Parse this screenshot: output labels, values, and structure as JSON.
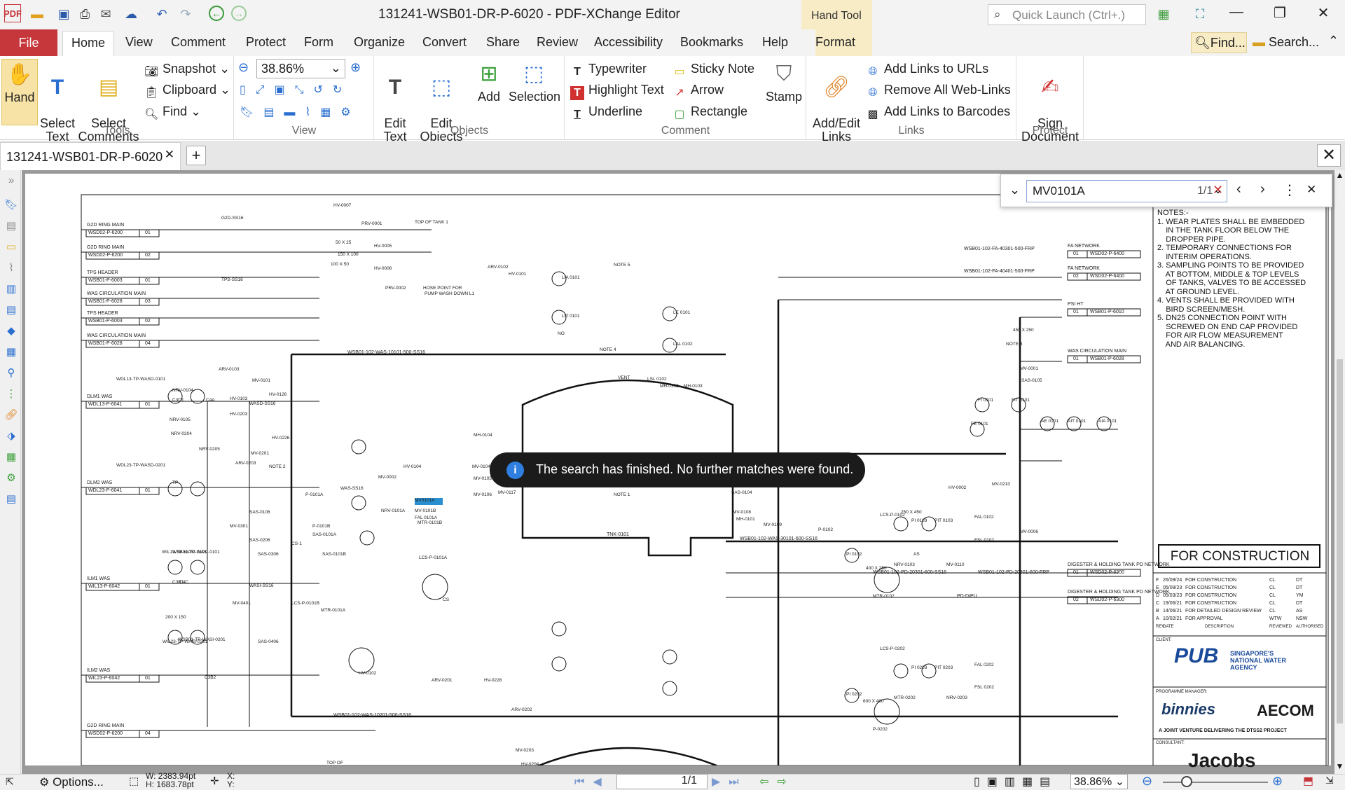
{
  "window": {
    "title": "131241-WSB01-DR-P-6020 - PDF-XChange Editor",
    "context_tab_group": "Hand Tool",
    "quick_launch_placeholder": "Quick Launch (Ctrl+.)"
  },
  "menu": {
    "file": "File",
    "tabs": [
      "Home",
      "View",
      "Comment",
      "Protect",
      "Form",
      "Organize",
      "Convert",
      "Share",
      "Review",
      "Accessibility",
      "Bookmarks",
      "Help"
    ],
    "context_tab": "Format",
    "find_label": "Find...",
    "search_label": "Search..."
  },
  "ribbon": {
    "tools": {
      "label": "Tools",
      "hand": "Hand",
      "select_text": "Select\nText",
      "select_comments": "Select\nComments",
      "snapshot": "Snapshot",
      "clipboard": "Clipboard",
      "find": "Find"
    },
    "view": {
      "label": "View",
      "zoom": "38.86%"
    },
    "objects": {
      "label": "Objects",
      "edit_text": "Edit\nText",
      "edit_objects": "Edit\nObjects",
      "add": "Add",
      "selection": "Selection"
    },
    "comment": {
      "label": "Comment",
      "typewriter": "Typewriter",
      "highlight": "Highlight Text",
      "underline": "Underline",
      "sticky": "Sticky Note",
      "arrow": "Arrow",
      "rectangle": "Rectangle",
      "stamp": "Stamp"
    },
    "links": {
      "label": "Links",
      "add_edit": "Add/Edit\nLinks",
      "add_urls": "Add Links to URLs",
      "remove_web": "Remove All Web-Links",
      "add_barcodes": "Add Links to Barcodes"
    },
    "protect": {
      "label": "Protect",
      "sign": "Sign\nDocument"
    }
  },
  "document_tab": {
    "name": "131241-WSB01-DR-P-6020"
  },
  "find_bar": {
    "query": "MV0101A",
    "count": "1/1"
  },
  "toast": {
    "message": "The search has finished. No further matches were found."
  },
  "drawing": {
    "notes_title": "NOTES:-",
    "notes": [
      "1. WEAR PLATES SHALL BE EMBEDDED",
      "    IN THE TANK FLOOR BELOW THE",
      "    DROPPER PIPE.",
      "2. TEMPORARY CONNECTIONS FOR",
      "    INTERIM OPERATIONS.",
      "3. SAMPLING POINTS TO BE PROVIDED",
      "    AT BOTTOM, MIDDLE & TOP LEVELS",
      "    OF TANKS, VALVES TO BE ACCESSED",
      "    AT GROUND LEVEL.",
      "4. VENTS SHALL BE PROVIDED WITH",
      "    BIRD SCREEN/MESH.",
      "5. DN25 CONNECTION POINT WITH",
      "    SCREWED ON END CAP PROVIDED",
      "    FOR AIR FLOW MEASUREMENT",
      "    AND AIR BALANCING."
    ],
    "stamp": "FOR CONSTRUCTION",
    "revisions": [
      [
        "F",
        "26/09/24",
        "FOR CONSTRUCTION",
        "CL",
        "DT"
      ],
      [
        "E",
        "05/09/23",
        "FOR CONSTRUCTION",
        "CL",
        "DT"
      ],
      [
        "D",
        "05/03/23",
        "FOR CONSTRUCTION",
        "CL",
        "YM"
      ],
      [
        "C",
        "19/06/21",
        "FOR CONSTRUCTION",
        "CL",
        "DT"
      ],
      [
        "B",
        "14/06/21",
        "FOR DETAILED DESIGN REVIEW",
        "CL",
        "AS"
      ],
      [
        "A",
        "10/02/21",
        "FOR APPROVAL",
        "WTW",
        "NSW"
      ]
    ],
    "rev_headers": [
      "REV",
      "DATE",
      "DESCRIPTION",
      "REVIEWED",
      "AUTHORISED"
    ],
    "client_label": "CLIENT:",
    "pub_text": "PUB",
    "pub_sub": "SINGAPORE'S NATIONAL WATER AGENCY",
    "pm_label": "PROGRAMME MANAGER:",
    "binnies": "binnies",
    "aecom": "AECOM",
    "jv_text": "A JOINT VENTURE DELIVERING THE DTSS2 PROJECT",
    "consultant_label": "CONSULTANT:",
    "jacobs": "Jacobs",
    "left_labels": [
      [
        "G2D RING MAIN",
        "WSD02-P-6200",
        "01"
      ],
      [
        "G2D RING MAIN",
        "WSD02-P-6200",
        "02"
      ],
      [
        "TPS HEADER",
        "WSB01-P-6003",
        "01"
      ],
      [
        "WAS CIRCULATION MAIN",
        "WSB01-P-6028",
        "03"
      ],
      [
        "TPS HEADER",
        "WSB01-P-6003",
        "02"
      ],
      [
        "WAS CIRCULATION MAIN",
        "WSB01-P-6028",
        "04"
      ],
      [
        "DLM1 WAS",
        "WDL13-P-6041",
        "01"
      ],
      [
        "DLM2 WAS",
        "WDL23-P-6041",
        "01"
      ],
      [
        "ILM1 WAS",
        "WIL13-P-6042",
        "01"
      ],
      [
        "ILM2 WAS",
        "WIL23-P-6042",
        "01"
      ],
      [
        "G2D RING MAIN",
        "WSD02-P-6200",
        "04"
      ]
    ],
    "right_labels": [
      [
        "FA NETWORK",
        "01",
        "WSD02-P-6400"
      ],
      [
        "FA NETWORK",
        "02",
        "WSD02-P-6400"
      ],
      [
        "PSI HT",
        "01",
        "WSB01-P-6010"
      ],
      [
        "WAS CIRCULATION MAIN",
        "01",
        "WSB01-P-6028"
      ],
      [
        "DIGESTER & HOLDING TANK PD NETWORK",
        "01",
        "WSD02-P-6300"
      ],
      [
        "DIGESTER & HOLDING TANK PD NETWORK",
        "02",
        "WSD02-P-6300"
      ]
    ],
    "line_labels": [
      "WSB01-102-FA-40301-500-FRP",
      "WSB01-102-FA-40401-500-FRP",
      "WSB01-102-WAS-10101-500-SS16",
      "WSB01-102-WAS-30101-600-SS16",
      "WSB01-102-PD-20301-600-SS16",
      "WSB01-102-PD-20301-600-FRP",
      "WSB01-102-WAS-10201-500-SS16",
      "PD-DIPU",
      "TNK-0101"
    ],
    "tags": [
      "HV-0007",
      "PRV-0001",
      "HV-0005",
      "HV-0006",
      "PRV-0002",
      "ARV-0102",
      "HV-0101",
      "LIA 0101",
      "LIT 0101",
      "LE 0101",
      "LAL 0102",
      "LSL 0102",
      "MH-0102",
      "MH-0103",
      "MH-0104",
      "MV-0104",
      "MV-0105",
      "MV-0106",
      "MV-0101B",
      "MV-0117",
      "SAS-0104",
      "MV-0108",
      "MH-0101",
      "MV-0109",
      "P-0102",
      "MTR-0102",
      "NRV-0103",
      "MV-0110",
      "P-0202",
      "MTR-0202",
      "NRV-0203",
      "MV-0210",
      "HV-0002",
      "SAS-0105",
      "MV-0006",
      "MV-0001",
      "MV-0002",
      "HV-0104",
      "NRV-0101A",
      "FAL 0101A",
      "P-0101A",
      "P-0101B",
      "MTR-0101A",
      "MTR-0101B",
      "CS-1",
      "SAS-0101A",
      "SAS-0101B",
      "LCS-P-0101A",
      "LCS-P-0101B",
      "LCS-P-0102",
      "LCS-P-0202",
      "ARV-0103",
      "MV-0101",
      "MV-0201",
      "ARV-0203",
      "MV-0301",
      "MV-0401",
      "SAS-0106",
      "SAS-0206",
      "SAS-0306",
      "SAS-0406",
      "HV-0102",
      "HV-0228",
      "ARV-0201",
      "ARV-0202",
      "MV-0203",
      "HV-0204",
      "NRV-0104",
      "HV-0103",
      "NRV-0105",
      "HV-0203",
      "NRV-0204",
      "HV-0126",
      "HV-0226",
      "NRV-0205",
      "FI 0101",
      "FIT 0101",
      "FE 0101",
      "AE 0101",
      "AIT 0101",
      "AIA 0101",
      "PI 0103",
      "PIT 0103",
      "PI 0203",
      "PIT 0203",
      "FAL 0102",
      "FSL 0102",
      "FAL 0202",
      "FSL 0202",
      "PI 0102",
      "PI 0202",
      "TP",
      "MV0101A"
    ],
    "misc_text": [
      "NOTE 1",
      "NOTE 2",
      "NOTE 3",
      "NOTE 4",
      "NOTE 5",
      "VENT",
      "HOSE POINT FOR",
      "PUMP WASH DOWN L1",
      "TOP OF TANK 1",
      "TOP OF",
      "150 X 100",
      "100 X 50",
      "50 X 25",
      "200 X 150",
      "450 X 250",
      "400 X 250",
      "600 X 400",
      "250 X 450",
      "WDL13-TP-WASD-0101",
      "WDL23-TP-WASD-0201",
      "WIL13-TP-WASI-0101",
      "WIL23-TP-WASI-0201",
      "WSB01-TP-WASI-0101",
      "WSB01-TP-WASI-0201",
      "G2D-SS16",
      "TPS-SS16",
      "WAS-SS16",
      "WASD-SS16",
      "WASI-SS16",
      "NC",
      "NO",
      "AS",
      "CS",
      "C3D1",
      "C4A",
      "C3B1",
      "C4C",
      "C3B2"
    ]
  },
  "status": {
    "options": "Options...",
    "width": "W: 2383.94pt",
    "height": "H: 1683.78pt",
    "x": "X:",
    "y": "Y:",
    "page": "1/1",
    "zoom": "38.86%"
  }
}
